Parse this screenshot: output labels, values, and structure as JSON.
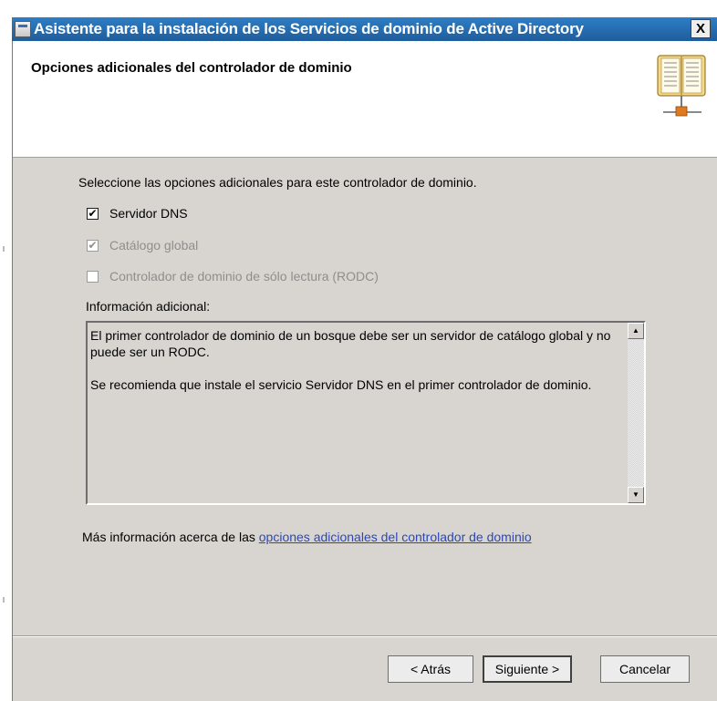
{
  "window": {
    "title": "Asistente para la instalación de los Servicios de dominio de Active Directory",
    "close_glyph": "X"
  },
  "header": {
    "title": "Opciones adicionales del controlador de dominio",
    "icon": "book-icon"
  },
  "content": {
    "instruction": "Seleccione las opciones adicionales para este controlador de dominio.",
    "options": [
      {
        "label": "Servidor DNS",
        "checked": true,
        "enabled": true,
        "mark": "✔"
      },
      {
        "label": "Catálogo global",
        "checked": true,
        "enabled": false,
        "mark": "✔"
      },
      {
        "label": "Controlador de dominio de sólo lectura (RODC)",
        "checked": false,
        "enabled": false,
        "mark": ""
      }
    ],
    "info_label": "Información adicional:",
    "info_paragraphs": [
      "El primer controlador de dominio de un bosque debe ser un servidor de catálogo global y no puede ser un RODC.",
      "Se recomienda que instale el servicio Servidor DNS en el primer controlador de dominio."
    ],
    "more_info_prefix": "Más información acerca de las ",
    "more_info_link": "opciones adicionales del controlador de dominio"
  },
  "buttons": {
    "back": "< Atrás",
    "next": "Siguiente >",
    "cancel": "Cancelar"
  },
  "colors": {
    "titlebar": "#1f5d9c",
    "dialog_background": "#d8d5d0",
    "link": "#2b48b8"
  }
}
